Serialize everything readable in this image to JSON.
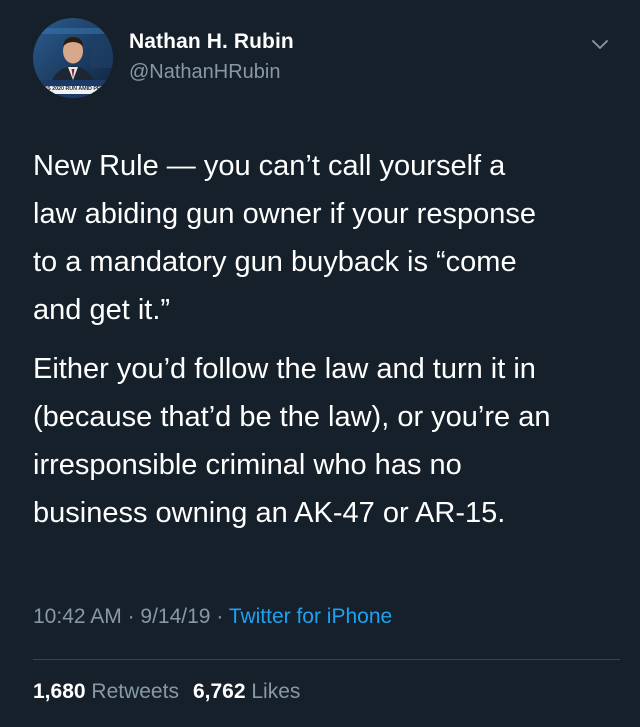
{
  "author": {
    "name": "Nathan H. Rubin",
    "handle": "@NathanHRubin",
    "avatar_caption": "XES 2020 RUN AMID PRO"
  },
  "tweet": {
    "paragraph1_lines": [
      "New Rule — you can’t call yourself a",
      "law abiding gun owner if your response",
      "to a mandatory gun buyback is “come",
      "and get it.”"
    ],
    "paragraph2_lines": [
      "Either you’d follow the law and turn it in",
      "(because that’d be the law), or you’re an",
      "irresponsible criminal who has no",
      "business owning an AK-47 or AR-15."
    ]
  },
  "meta": {
    "time": "10:42 AM",
    "separator": " · ",
    "date": "9/14/19",
    "source": "Twitter for iPhone"
  },
  "stats": {
    "retweets_count": "1,680",
    "retweets_label": "Retweets",
    "likes_count": "6,762",
    "likes_label": "Likes"
  },
  "colors": {
    "background": "#15202b",
    "secondary_text": "#8899a6",
    "link": "#1da1f2",
    "divider": "#38444d"
  },
  "icons": {
    "caret": "chevron-down-icon"
  }
}
